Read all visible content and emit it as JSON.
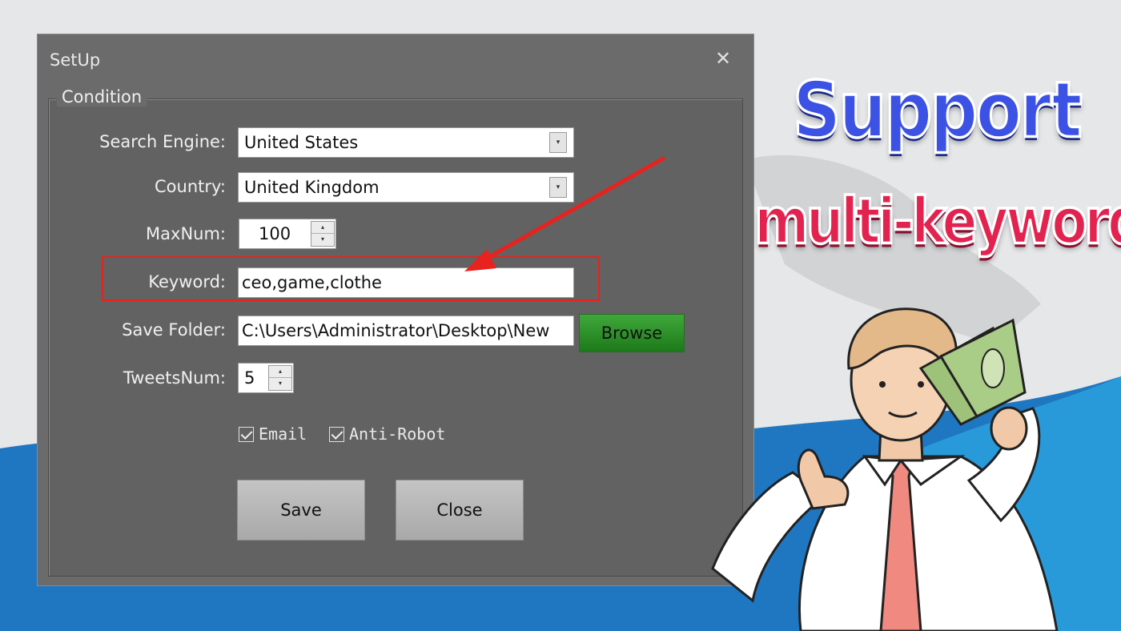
{
  "dialog": {
    "title": "SetUp",
    "close_glyph": "✕",
    "group_caption": "Condition",
    "fields": {
      "search_engine": {
        "label": "Search Engine:",
        "value": "United States"
      },
      "country": {
        "label": "Country:",
        "value": "United Kingdom"
      },
      "maxnum": {
        "label": "MaxNum:",
        "value": "100"
      },
      "keyword": {
        "label": "Keyword:",
        "value": "ceo,game,clothe"
      },
      "save_folder": {
        "label": "Save Folder:",
        "value": "C:\\Users\\Administrator\\Desktop\\New"
      },
      "tweetsnum": {
        "label": "TweetsNum:",
        "value": "5"
      }
    },
    "browse_label": "Browse",
    "checkboxes": {
      "email": "Email",
      "anti_robot": "Anti-Robot"
    },
    "save_label": "Save",
    "close_label": "Close"
  },
  "promo": {
    "line1": "Support",
    "line2": "multi-keyword"
  },
  "colors": {
    "highlight": "#e8221e",
    "browse": "#2a8f27",
    "promo_blue": "#3b52e5",
    "promo_red": "#e3234f"
  },
  "icons": {
    "dropdown": "chevron-down-icon",
    "spin": "spin-arrows-icon",
    "check": "checkmark-icon",
    "close": "close-icon"
  }
}
